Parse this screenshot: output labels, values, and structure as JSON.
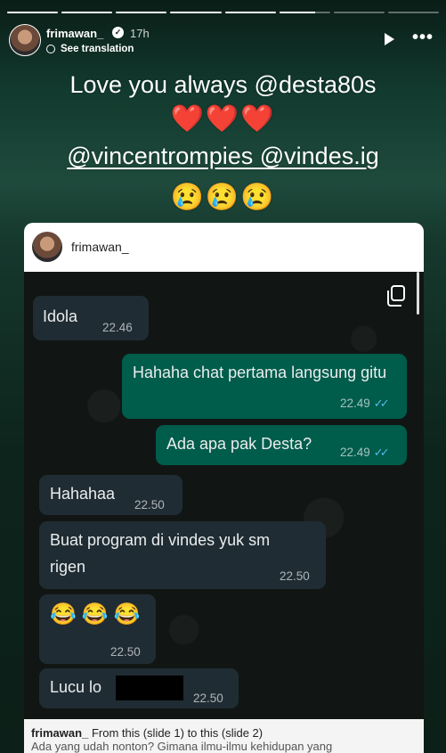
{
  "story": {
    "progress_segments": [
      1,
      1,
      1,
      1,
      1,
      0.7,
      0,
      0
    ],
    "header": {
      "username": "frimawan_",
      "verified_icon": "verified-badge-icon",
      "time": "17h",
      "see_translation": "See translation"
    },
    "caption": {
      "line1": "Love you always @desta80s",
      "hearts": "❤️❤️❤️",
      "line3": "@vincentrompies @vindes.ig",
      "crying": "😢😢😢"
    },
    "card": {
      "username": "frimawan_",
      "messages": [
        {
          "dir": "in",
          "text": "Idola",
          "time": "22.46"
        },
        {
          "dir": "out",
          "text": "Hahaha chat pertama langsung gitu",
          "time": "22.49",
          "ticks": "✓✓"
        },
        {
          "dir": "out",
          "text": "Ada apa pak Desta?",
          "time": "22.49",
          "ticks": "✓✓"
        },
        {
          "dir": "in",
          "text": "Hahahaa",
          "time": "22.50"
        },
        {
          "dir": "in",
          "text": "Buat program di vindes yuk sm rigen",
          "time": "22.50"
        },
        {
          "dir": "in",
          "text": "😂😂😂",
          "time": "22.50"
        },
        {
          "dir": "in",
          "text": "Lucu lo",
          "time": "22.50"
        }
      ]
    },
    "footer": {
      "username": "frimawan_",
      "line1": "From this (slide 1) to this (slide 2)",
      "line2": "Ada yang udah nonton? Gimana ilmu-ilmu kehidupan yang"
    }
  },
  "colors": {
    "incoming_bubble": "#202c33",
    "outgoing_bubble": "#005c4b",
    "read_ticks": "#53bdeb",
    "hearts": "#e0203b"
  }
}
